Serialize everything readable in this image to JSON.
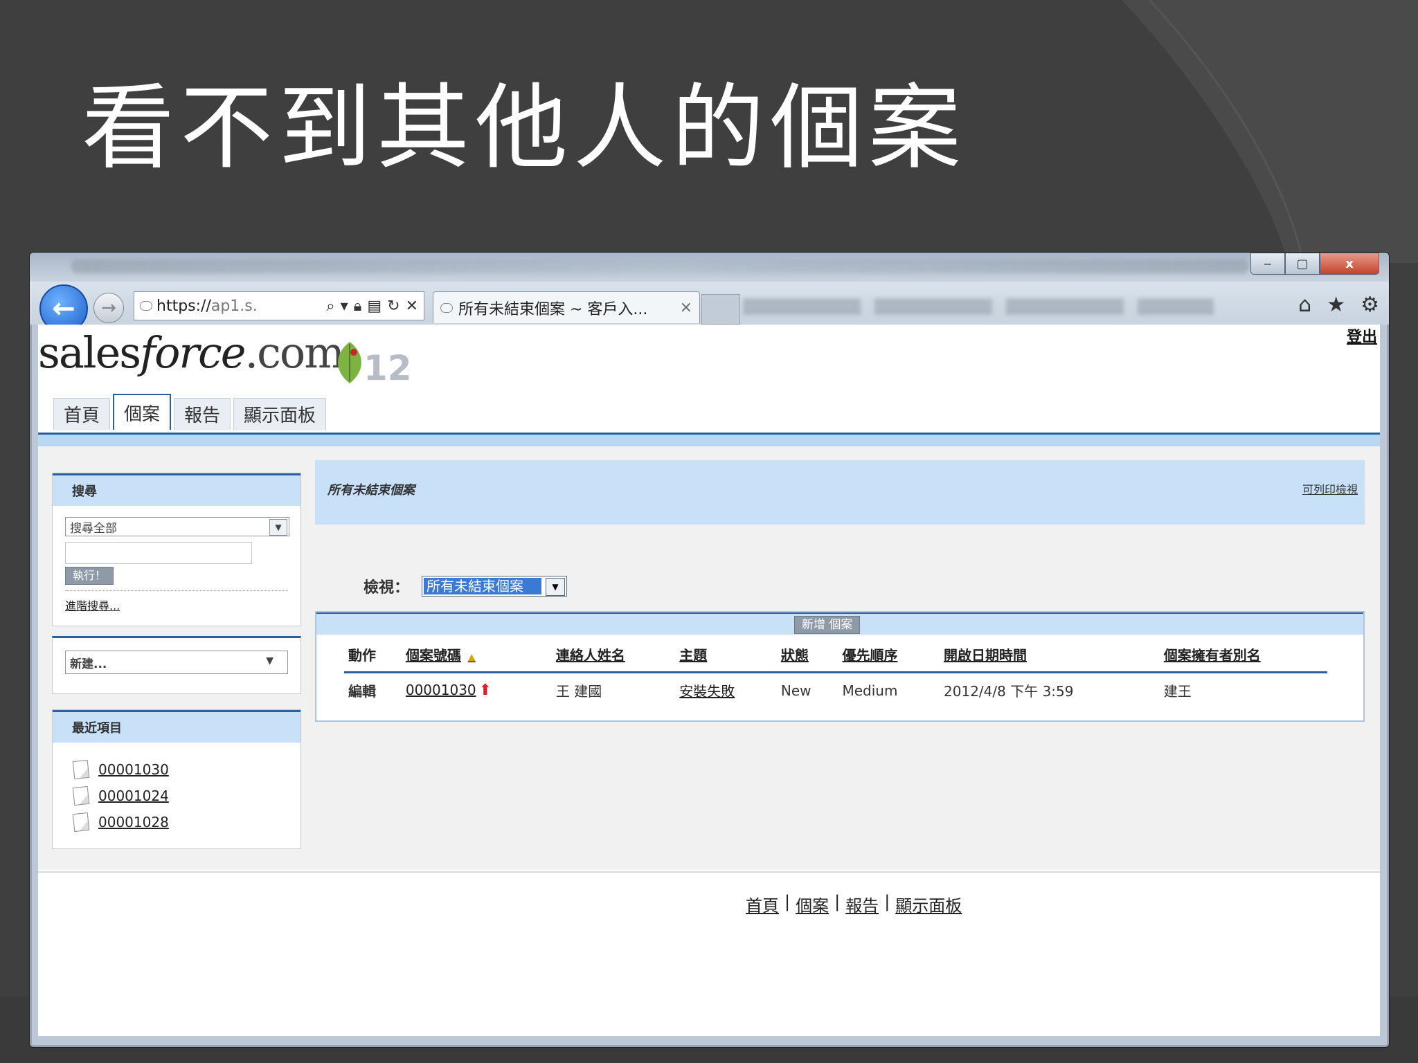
{
  "slide": {
    "title": "看不到其他人的個案"
  },
  "window": {
    "min_glyph": "‒",
    "max_glyph": "▢",
    "close_glyph": "x"
  },
  "browser": {
    "back_glyph": "←",
    "forward_glyph": "→",
    "address_prefix": "https://",
    "address_rest": "ap1.s.",
    "address_icons": [
      "search-icon",
      "dropdown-icon",
      "lock-icon",
      "compat-icon",
      "refresh-icon",
      "stop-icon"
    ],
    "tab_title": "所有未結束個案 ~ 客戶入...",
    "tab_close": "×",
    "toolbar_icons": [
      "home-icon",
      "star-icon",
      "gear-icon"
    ]
  },
  "sf": {
    "logo_sales": "sales",
    "logo_force": "force",
    "logo_com": ".com",
    "version": "12",
    "logout": "登出",
    "tabs": [
      "首頁",
      "個案",
      "報告",
      "顯示面板"
    ],
    "active_tab": 1
  },
  "sidebar": {
    "search": {
      "header": "搜尋",
      "scope": "搜尋全部",
      "go_label": "執行！",
      "advanced_link": "進階搜尋..."
    },
    "create": {
      "label": "新建..."
    },
    "recent": {
      "header": "最近項目",
      "items": [
        "00001030",
        "00001024",
        "00001028"
      ]
    }
  },
  "main": {
    "title": "所有未結束個案",
    "printable": "可列印檢視",
    "view_label": "檢視：",
    "view_value": "所有未結束個案",
    "new_button": "新增 個案",
    "columns": [
      "動作",
      "個案號碼",
      "連絡人姓名",
      "主題",
      "狀態",
      "優先順序",
      "開啟日期時間",
      "個案擁有者別名"
    ],
    "rows": [
      {
        "action": "編輯",
        "case_number": "00001030",
        "contact": "王 建國",
        "subject": "安裝失敗",
        "status": "New",
        "priority": "Medium",
        "opened": "2012/4/8 下午 3:59",
        "owner_alias": "建王"
      }
    ]
  },
  "footer": {
    "links": [
      "首頁",
      "個案",
      "報告",
      "顯示面板"
    ],
    "separator": "|"
  }
}
